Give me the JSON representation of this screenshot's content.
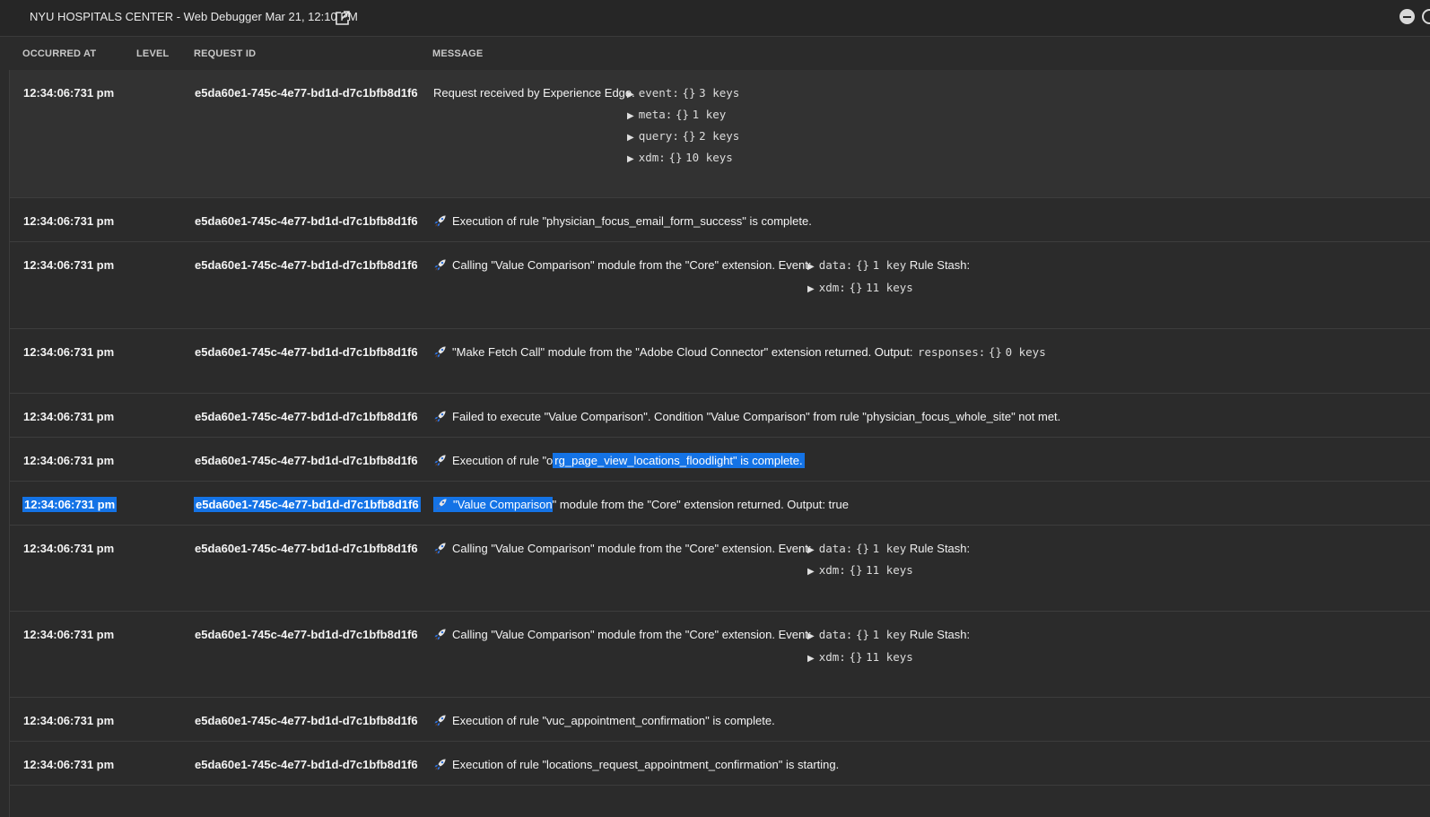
{
  "window": {
    "title": "NYU HOSPITALS CENTER - Web Debugger Mar 21, 12:10 PM"
  },
  "columns": {
    "occurred_at": "OCCURRED AT",
    "level": "LEVEL",
    "request_id": "REQUEST ID",
    "message": "MESSAGE"
  },
  "rows": [
    {
      "time": "12:34:06:731 pm",
      "request_id": "e5da60e1-745c-4e77-bd1d-d7c1bfb8d1f6",
      "message": "Request received by Experience Edge.",
      "props": [
        {
          "key": "event:",
          "type": "{}",
          "count": "3 keys"
        },
        {
          "key": "meta:",
          "type": "{}",
          "count": "1 key"
        },
        {
          "key": "query:",
          "type": "{}",
          "count": "2 keys"
        },
        {
          "key": "xdm:",
          "type": "{}",
          "count": "10 keys"
        }
      ]
    },
    {
      "time": "12:34:06:731 pm",
      "request_id": "e5da60e1-745c-4e77-bd1d-d7c1bfb8d1f6",
      "message": "Execution of rule \"physician_focus_email_form_success\" is complete."
    },
    {
      "time": "12:34:06:731 pm",
      "request_id": "e5da60e1-745c-4e77-bd1d-d7c1bfb8d1f6",
      "message": "Calling \"Value Comparison\" module from the \"Core\" extension. Event:",
      "props": [
        {
          "key": "data:",
          "type": "{}",
          "count": "1 key",
          "suffix": "Rule Stash:"
        },
        {
          "key": "xdm:",
          "type": "{}",
          "count": "11 keys"
        }
      ]
    },
    {
      "time": "12:34:06:731 pm",
      "request_id": "e5da60e1-745c-4e77-bd1d-d7c1bfb8d1f6",
      "message": "\"Make Fetch Call\" module from the \"Adobe Cloud Connector\" extension returned. Output:",
      "props": [
        {
          "key": "responses:",
          "type": "{}",
          "count": "0 keys"
        }
      ]
    },
    {
      "time": "12:34:06:731 pm",
      "request_id": "e5da60e1-745c-4e77-bd1d-d7c1bfb8d1f6",
      "message": "Failed to execute \"Value Comparison\". Condition \"Value Comparison\" from rule \"physician_focus_whole_site\" not met."
    },
    {
      "time": "12:34:06:731 pm",
      "request_id": "e5da60e1-745c-4e77-bd1d-d7c1bfb8d1f6",
      "message_a": "Execution of rule \"o",
      "message_b": "rg_page_view_locations_floodlight\" is complete. "
    },
    {
      "time": "12:34:06:731 pm",
      "request_id": "e5da60e1-745c-4e77-bd1d-d7c1bfb8d1f6",
      "message_a": "\"Value Comparison",
      "message_b": "\" module from the \"Core\" extension returned. Output: true"
    },
    {
      "time": "12:34:06:731 pm",
      "request_id": "e5da60e1-745c-4e77-bd1d-d7c1bfb8d1f6",
      "message": "Calling \"Value Comparison\" module from the \"Core\" extension. Event:",
      "props": [
        {
          "key": "data:",
          "type": "{}",
          "count": "1 key",
          "suffix": "Rule Stash:"
        },
        {
          "key": "xdm:",
          "type": "{}",
          "count": "11 keys"
        }
      ]
    },
    {
      "time": "12:34:06:731 pm",
      "request_id": "e5da60e1-745c-4e77-bd1d-d7c1bfb8d1f6",
      "message": "Calling \"Value Comparison\" module from the \"Core\" extension. Event:",
      "props": [
        {
          "key": "data:",
          "type": "{}",
          "count": "1 key",
          "suffix": "Rule Stash:"
        },
        {
          "key": "xdm:",
          "type": "{}",
          "count": "11 keys"
        }
      ]
    },
    {
      "time": "12:34:06:731 pm",
      "request_id": "e5da60e1-745c-4e77-bd1d-d7c1bfb8d1f6",
      "message": "Execution of rule \"vuc_appointment_confirmation\" is complete."
    },
    {
      "time": "12:34:06:731 pm",
      "request_id": "e5da60e1-745c-4e77-bd1d-d7c1bfb8d1f6",
      "message": "Execution of rule \"locations_request_appointment_confirmation\" is starting."
    }
  ],
  "colors": {
    "background": "#2b2b2b",
    "selection": "#1473e6",
    "text": "#f0f0f0"
  }
}
